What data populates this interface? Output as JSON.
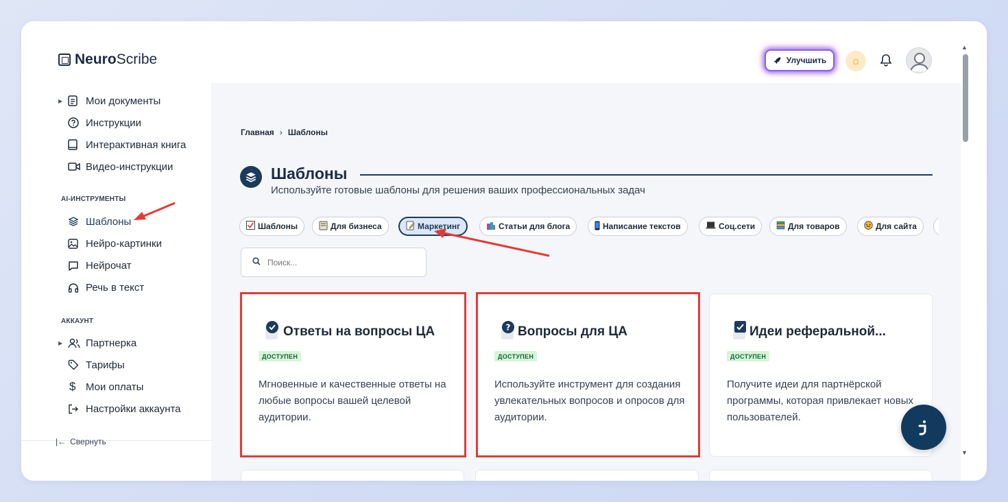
{
  "app": {
    "brand_bold": "Neuro",
    "brand_rest": "Scribe"
  },
  "header": {
    "upgrade_label": "Улучшить"
  },
  "sidebar": {
    "items_top": [
      {
        "label": "Мои документы",
        "icon": "document-icon",
        "has_caret": true
      },
      {
        "label": "Инструкции",
        "icon": "help-circle-icon"
      },
      {
        "label": "Интерактивная книга",
        "icon": "book-icon"
      },
      {
        "label": "Видео-инструкции",
        "icon": "video-icon"
      }
    ],
    "section_ai": "AI-ИНСТРУМЕНТЫ",
    "items_ai": [
      {
        "label": "Шаблоны",
        "icon": "layers-icon",
        "active": true
      },
      {
        "label": "Нейро-картинки",
        "icon": "image-icon"
      },
      {
        "label": "Нейрочат",
        "icon": "chat-icon"
      },
      {
        "label": "Речь в текст",
        "icon": "headphones-icon"
      }
    ],
    "section_account": "АККАУНТ",
    "items_account": [
      {
        "label": "Партнерка",
        "icon": "users-icon",
        "has_caret": true
      },
      {
        "label": "Тарифы",
        "icon": "tag-icon"
      },
      {
        "label": "Мои оплаты",
        "icon": "dollar-icon"
      },
      {
        "label": "Настройки аккаунта",
        "icon": "logout-icon"
      }
    ],
    "collapse_label": "Свернуть"
  },
  "breadcrumb": {
    "home": "Главная",
    "current": "Шаблоны"
  },
  "page": {
    "title": "Шаблоны",
    "subtitle": "Используйте готовые шаблоны для решения ваших профессиональных задач"
  },
  "filters": [
    {
      "label": "Шаблоны",
      "icon": "checkbox-emoji"
    },
    {
      "label": "Для бизнеса",
      "icon": "ledger-emoji"
    },
    {
      "label": "Маркетинг",
      "icon": "memo-emoji",
      "active": true
    },
    {
      "label": "Статьи для блога",
      "icon": "building-emoji"
    },
    {
      "label": "Написание текстов",
      "icon": "phone-emoji"
    },
    {
      "label": "Соц.сети",
      "icon": "laptop-emoji"
    },
    {
      "label": "Для товаров",
      "icon": "books-emoji"
    },
    {
      "label": "Для сайта",
      "icon": "mask-emoji"
    }
  ],
  "search": {
    "placeholder": "Поиск..."
  },
  "cards": [
    {
      "title": "Ответы на вопросы ЦА",
      "badge": "ДОСТУПЕН",
      "description": "Мгновенные и качественные ответы на любые вопросы вашей целевой аудитории.",
      "icon": "check-badge-icon",
      "highlighted": true
    },
    {
      "title": "Вопросы для ЦА",
      "badge": "ДОСТУПЕН",
      "description": "Используйте инструмент для создания увлекательных вопросов и опросов для аудитории.",
      "icon": "question-badge-icon",
      "highlighted": true
    },
    {
      "title": "Идеи реферальной...",
      "badge": "ДОСТУПЕН",
      "description": "Получите идеи для партнёрской программы, которая привлекает новых пользователей.",
      "icon": "checkbox-icon",
      "highlighted": false
    }
  ],
  "colors": {
    "accent": "#1b3a5c",
    "highlight": "#e53935",
    "badge_bg": "#d6f5d9",
    "badge_text": "#166534"
  }
}
